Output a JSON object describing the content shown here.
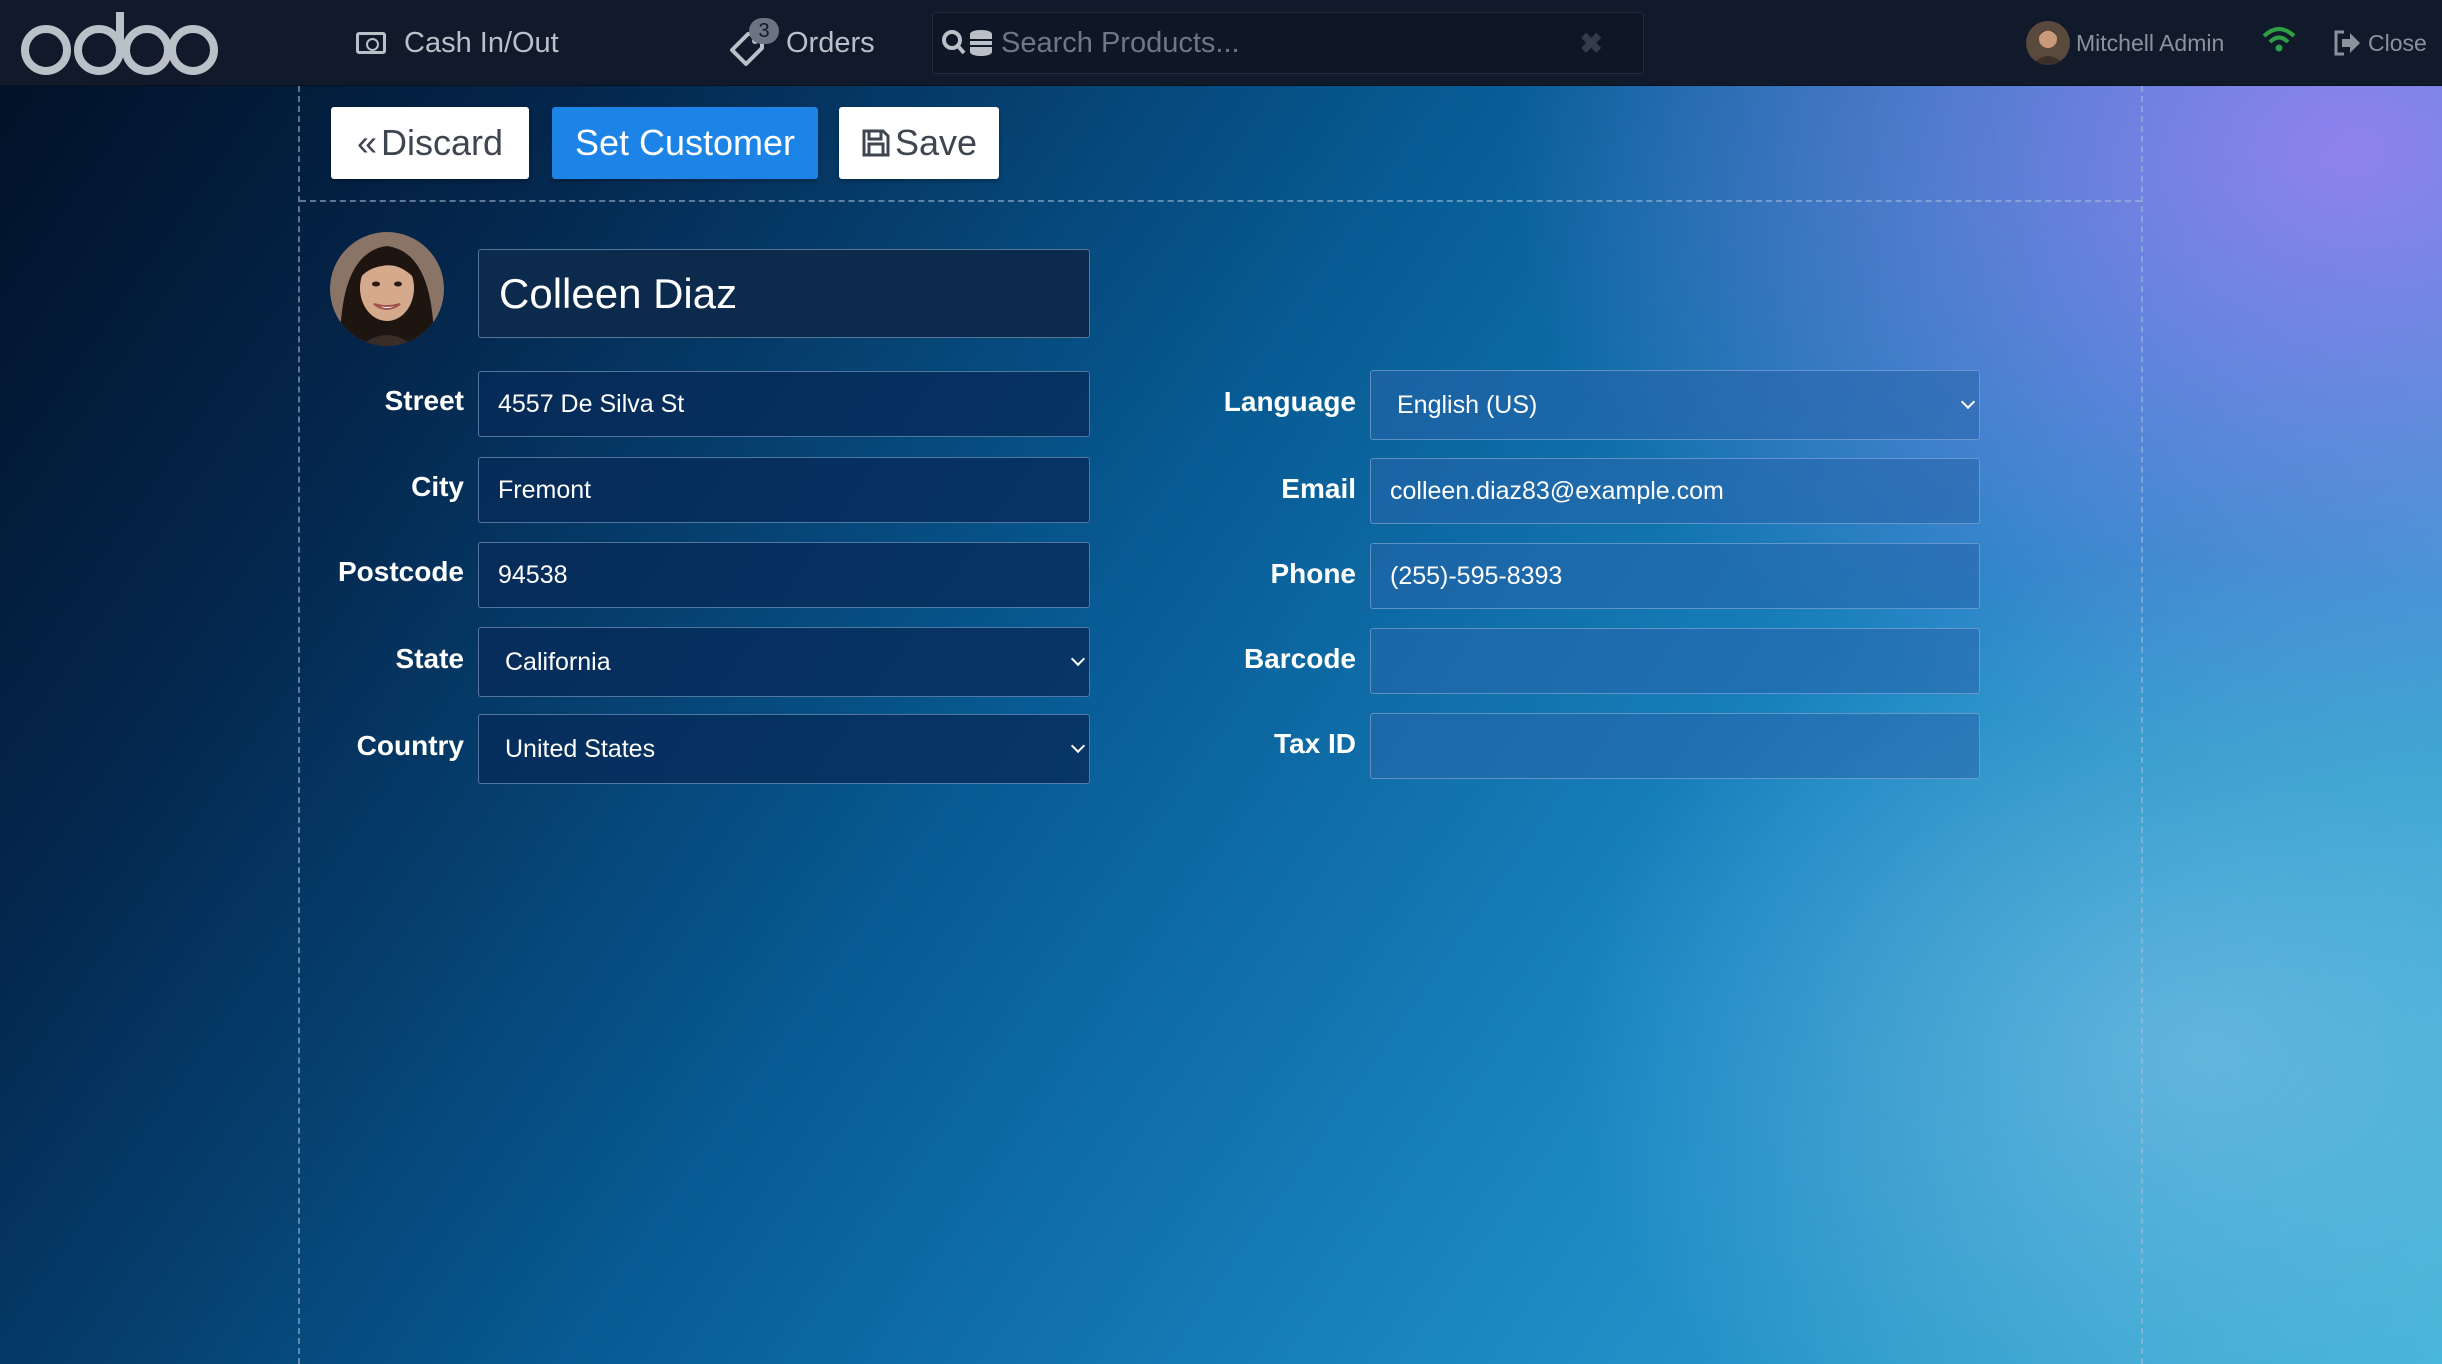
{
  "app": {
    "logo_text": "odoo"
  },
  "topbar": {
    "cash_label": "Cash In/Out",
    "orders_label": "Orders",
    "orders_count": "3",
    "search_placeholder": "Search Products...",
    "user_name": "Mitchell Admin",
    "close_label": "Close"
  },
  "actions": {
    "discard_label": "Discard",
    "set_customer_label": "Set Customer",
    "save_label": "Save"
  },
  "customer": {
    "name": "Colleen Diaz",
    "labels": {
      "street": "Street",
      "city": "City",
      "postcode": "Postcode",
      "state": "State",
      "country": "Country",
      "language": "Language",
      "email": "Email",
      "phone": "Phone",
      "barcode": "Barcode",
      "tax_id": "Tax ID"
    },
    "values": {
      "street": "4557 De Silva St",
      "city": "Fremont",
      "postcode": "94538",
      "state": "California",
      "country": "United States",
      "language": "English (US)",
      "email": "colleen.diaz83@example.com",
      "phone": "(255)-595-8393",
      "barcode": "",
      "tax_id": ""
    }
  },
  "colors": {
    "topbar": "#101a2a",
    "primary_button": "#1b84e6",
    "wifi_status": "#2ea043"
  }
}
